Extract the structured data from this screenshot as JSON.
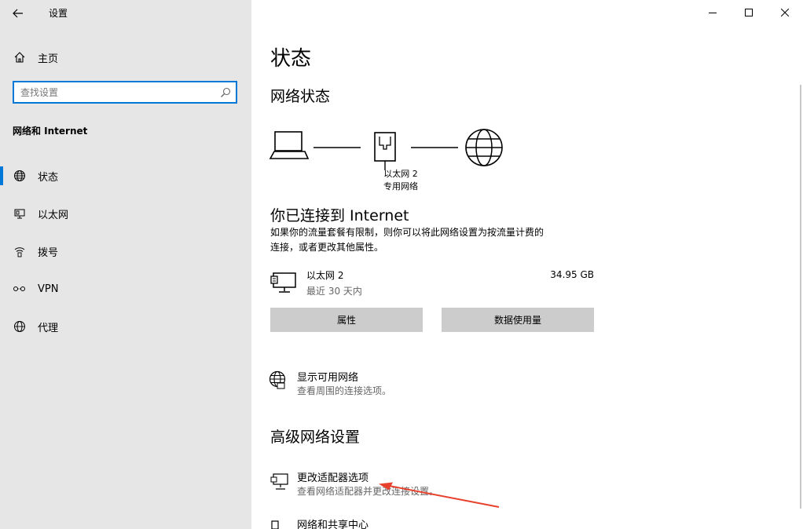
{
  "window": {
    "title": "设置",
    "controls": {
      "minimize": "minimize-icon",
      "maximize": "maximize-icon",
      "close": "close-icon"
    }
  },
  "sidebar": {
    "home_label": "主页",
    "search_placeholder": "查找设置",
    "section_title": "网络和 Internet",
    "items": [
      {
        "label": "状态",
        "icon": "globe-icon",
        "selected": true
      },
      {
        "label": "以太网",
        "icon": "ethernet-icon",
        "selected": false
      },
      {
        "label": "拨号",
        "icon": "dialup-icon",
        "selected": false
      },
      {
        "label": "VPN",
        "icon": "vpn-icon",
        "selected": false
      },
      {
        "label": "代理",
        "icon": "globe-icon",
        "selected": false
      }
    ]
  },
  "main": {
    "page_title": "状态",
    "network_status_heading": "网络状态",
    "diagram": {
      "adapter_name": "以太网 2",
      "network_type": "专用网络"
    },
    "connected_heading": "你已连接到 Internet",
    "connected_desc_line1": "如果你的流量套餐有限制，则你可以将此网络设置为按流量计费的",
    "connected_desc_line2": "连接，或者更改其他属性。",
    "connection": {
      "name": "以太网 2",
      "period": "最近 30 天内",
      "usage": "34.95 GB"
    },
    "buttons": {
      "properties": "属性",
      "data_usage": "数据使用量"
    },
    "show_networks": {
      "title": "显示可用网络",
      "subtitle": "查看周围的连接选项。"
    },
    "advanced_heading": "高级网络设置",
    "adapter_options": {
      "title": "更改适配器选项",
      "subtitle": "查看网络适配器并更改连接设置。"
    },
    "sharing_center": {
      "title": "网络和共享中心"
    }
  },
  "colors": {
    "accent": "#0078d7",
    "sidebar_bg": "#e6e6e6",
    "button_bg": "#cccccc",
    "annotation_arrow": "#e8412c"
  }
}
